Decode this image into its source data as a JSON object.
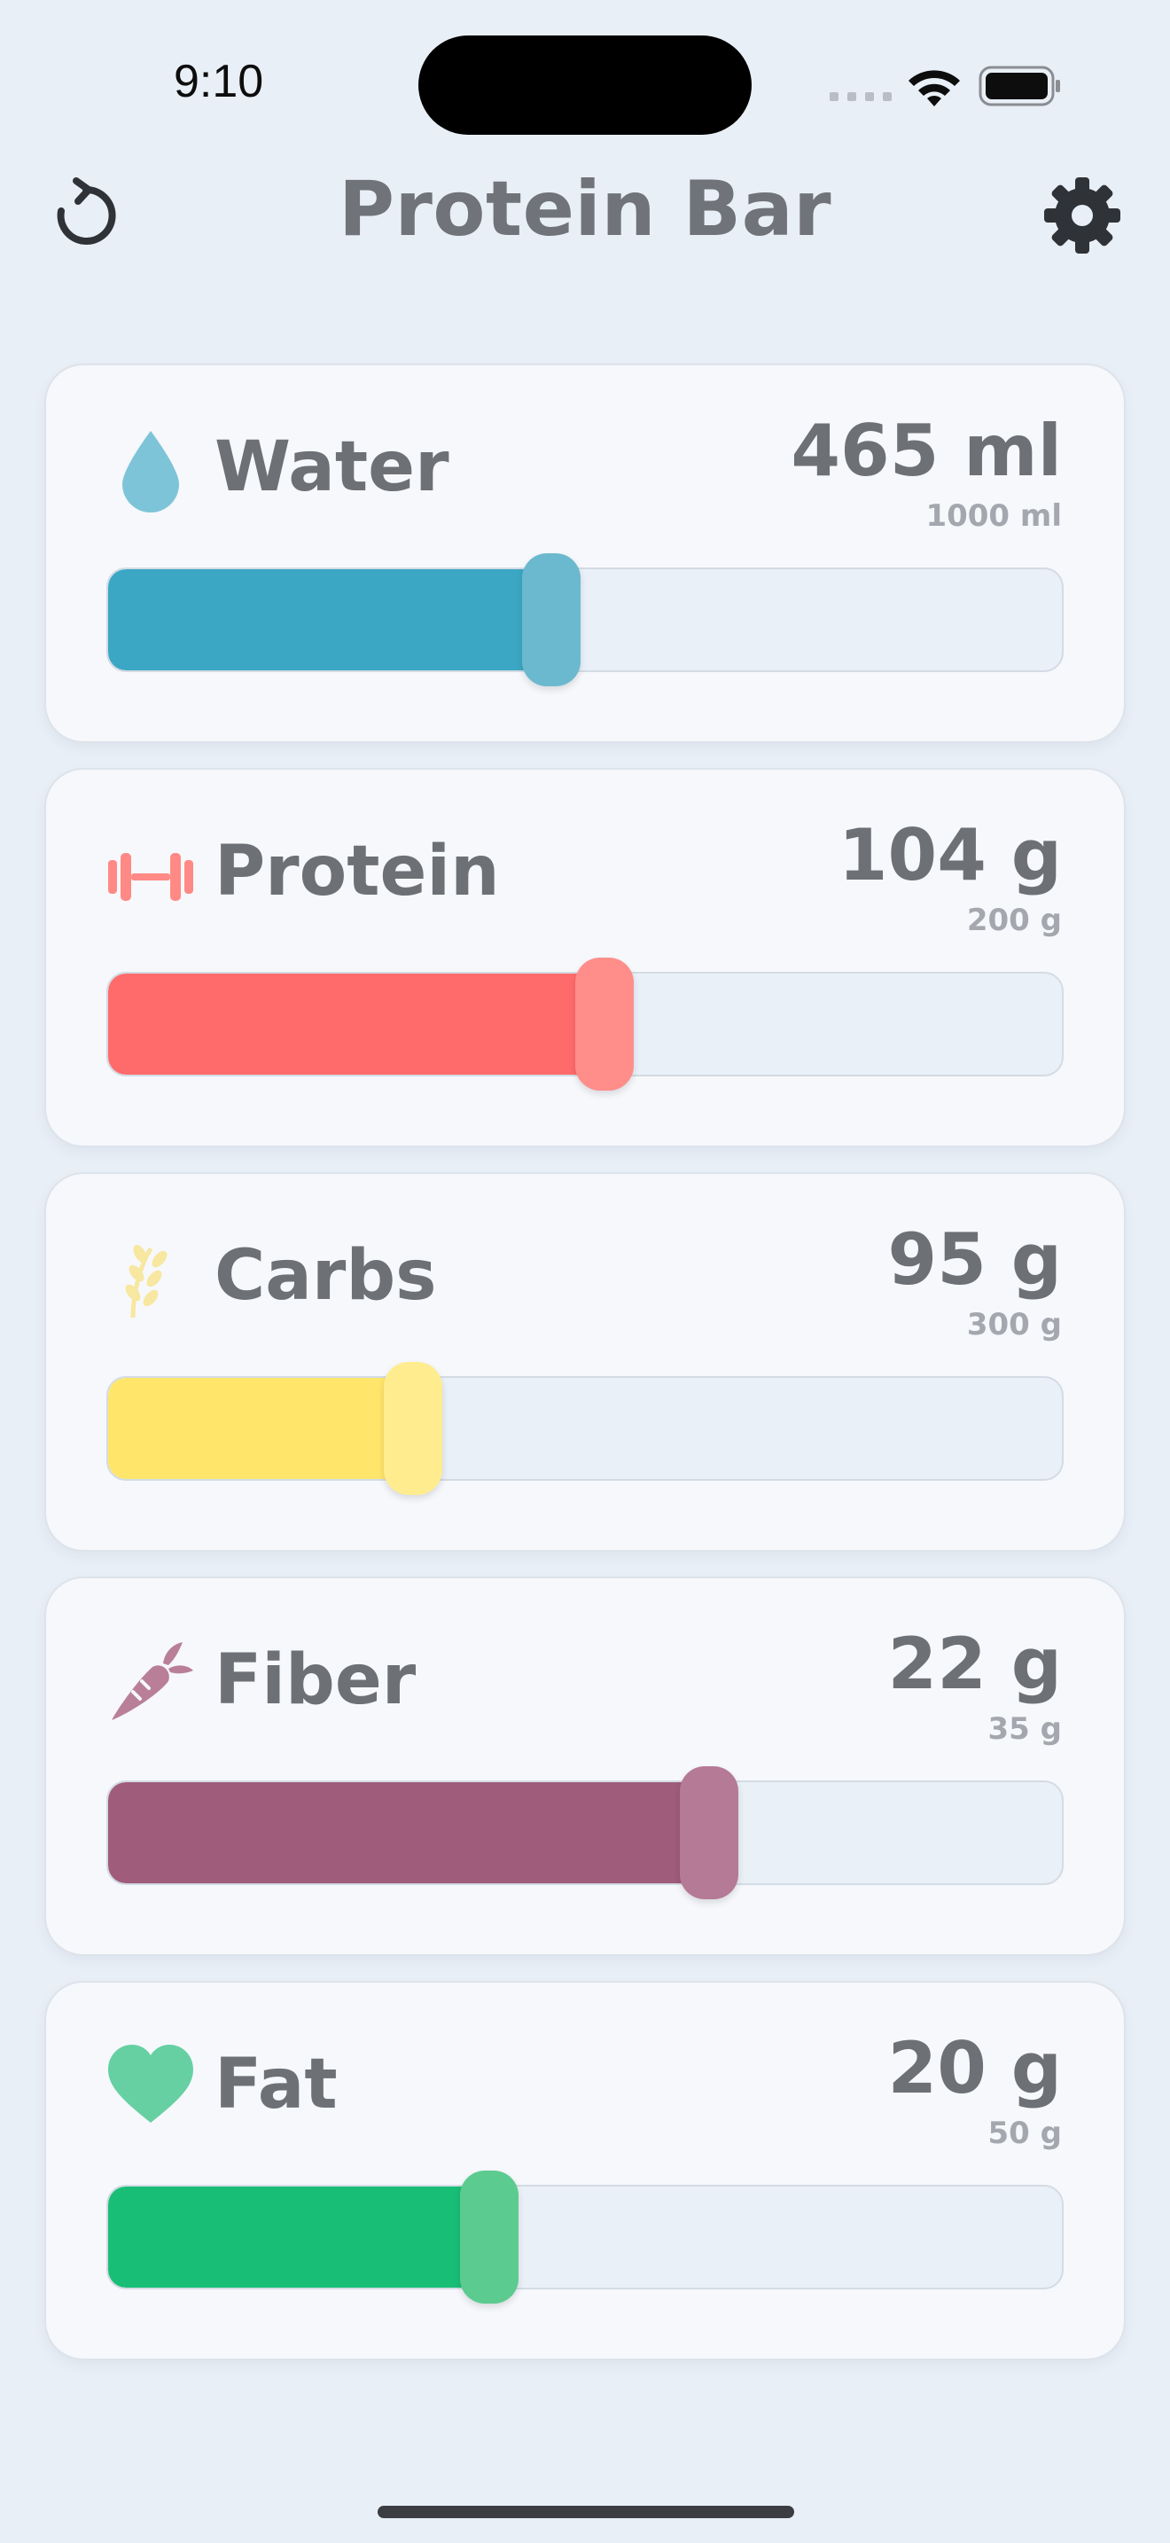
{
  "status": {
    "time": "9:10"
  },
  "header": {
    "title": "Protein Bar"
  },
  "nutrients": [
    {
      "key": "water",
      "icon": "water-drop-icon",
      "label": "Water",
      "value": "465 ml",
      "goal": "1000 ml",
      "fraction": 0.465,
      "fill_color": "#3ba7c4",
      "thumb_color": "#6bb9cf",
      "icon_color": "#7ec4d8"
    },
    {
      "key": "protein",
      "icon": "dumbbell-icon",
      "label": "Protein",
      "value": "104 g",
      "goal": "200 g",
      "fraction": 0.52,
      "fill_color": "#ff6b6b",
      "thumb_color": "#ff8e8a",
      "icon_color": "#ff8a85"
    },
    {
      "key": "carbs",
      "icon": "wheat-icon",
      "label": "Carbs",
      "value": "95 g",
      "goal": "300 g",
      "fraction": 0.32,
      "fill_color": "#ffe66b",
      "thumb_color": "#ffec8f",
      "icon_color": "#f7e7a0"
    },
    {
      "key": "fiber",
      "icon": "carrot-icon",
      "label": "Fiber",
      "value": "22 g",
      "goal": "35 g",
      "fraction": 0.63,
      "fill_color": "#a05c7b",
      "thumb_color": "#b57a95",
      "icon_color": "#b97f99"
    },
    {
      "key": "fat",
      "icon": "heart-icon",
      "label": "Fat",
      "value": "20 g",
      "goal": "50 g",
      "fraction": 0.4,
      "fill_color": "#19be76",
      "thumb_color": "#5ccb8f",
      "icon_color": "#66d0a2"
    }
  ]
}
